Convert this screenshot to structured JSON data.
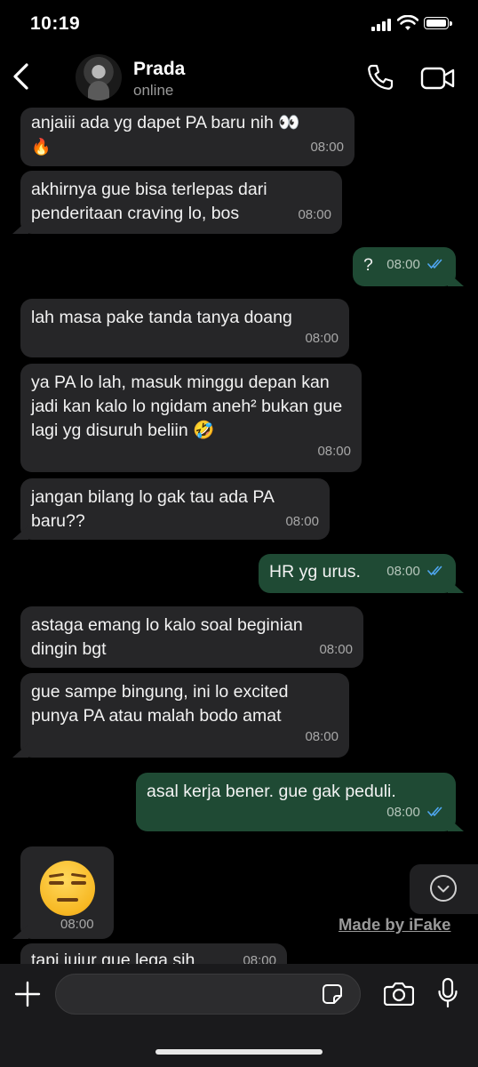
{
  "status_bar": {
    "time": "10:19"
  },
  "header": {
    "back_icon": "chevron-left-icon",
    "contact_name": "Prada",
    "contact_status": "online",
    "call_icon": "phone-icon",
    "video_icon": "video-camera-icon"
  },
  "messages": [
    {
      "direction": "incoming",
      "text": "anjaiii ada yg dapet PA baru nih 👀",
      "emoji_line": "🔥",
      "time": "08:00"
    },
    {
      "direction": "incoming",
      "text": "akhirnya gue bisa terlepas dari penderitaan craving lo, bos",
      "time": "08:00"
    },
    {
      "direction": "outgoing",
      "text": "?",
      "time": "08:00",
      "read": true
    },
    {
      "direction": "incoming",
      "text": "lah masa pake tanda tanya doang",
      "time": "08:00"
    },
    {
      "direction": "incoming",
      "text": "ya PA lo lah, masuk minggu depan kan jadi kan kalo lo ngidam aneh² bukan gue lagi yg disuruh beliin 🤣",
      "time": "08:00"
    },
    {
      "direction": "incoming",
      "text": "jangan bilang lo gak tau ada PA baru??",
      "time": "08:00"
    },
    {
      "direction": "outgoing",
      "text": "HR yg urus.",
      "time": "08:00",
      "read": true
    },
    {
      "direction": "incoming",
      "text": "astaga emang lo kalo soal beginian dingin bgt",
      "time": "08:00"
    },
    {
      "direction": "incoming",
      "text": "gue sampe bingung, ini lo excited punya PA atau malah bodo amat",
      "time": "08:00"
    },
    {
      "direction": "outgoing",
      "text": "asal kerja bener. gue gak peduli.",
      "time": "08:00",
      "read": true
    },
    {
      "direction": "incoming",
      "emoji_only": "expressionless-face",
      "time": "08:00"
    },
    {
      "direction": "incoming",
      "text": "tapi jujur gue lega sih",
      "time": "08:00"
    }
  ],
  "scroll_down_icon": "chevron-down-icon",
  "watermark": "Made by iFake",
  "input_bar": {
    "plus_icon": "plus-icon",
    "placeholder": "",
    "sticker_icon": "sticker-icon",
    "camera_icon": "camera-icon",
    "mic_icon": "microphone-icon"
  },
  "colors": {
    "background": "#000000",
    "incoming_bubble": "#262628",
    "outgoing_bubble": "#1f4a34",
    "read_ticks": "#4fa6f0"
  }
}
